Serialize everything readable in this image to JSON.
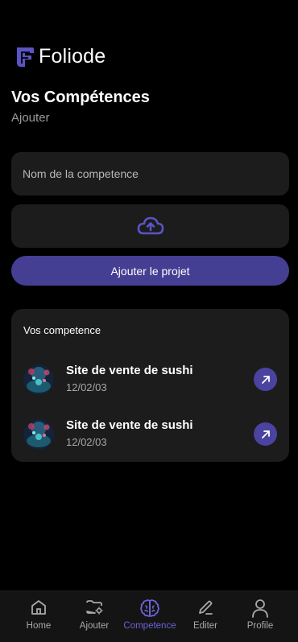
{
  "app": {
    "name": "Foliode"
  },
  "page": {
    "title": "Vos Compétences",
    "subtitle": "Ajouter"
  },
  "form": {
    "name_placeholder": "Nom de la competence",
    "name_value": "",
    "upload_icon": "cloud-upload-icon",
    "submit_label": "Ajouter le projet"
  },
  "list": {
    "title": "Vos competence",
    "items": [
      {
        "title": "Site de vente de sushi",
        "date": "12/02/03",
        "action_icon": "arrow-up-right-icon"
      },
      {
        "title": "Site de vente de sushi",
        "date": "12/02/03",
        "action_icon": "arrow-up-right-icon"
      }
    ]
  },
  "nav": {
    "active": "Competence",
    "items": [
      {
        "label": "Home",
        "icon": "home-icon"
      },
      {
        "label": "Ajouter",
        "icon": "folder-settings-icon"
      },
      {
        "label": "Competence",
        "icon": "brain-icon"
      },
      {
        "label": "Editer",
        "icon": "pencil-icon"
      },
      {
        "label": "Profile",
        "icon": "user-icon"
      }
    ]
  },
  "colors": {
    "background": "#000000",
    "card": "#1c1c1c",
    "accent": "#453f93",
    "accent_active": "#6c63d6",
    "muted_text": "#9a9a9a"
  }
}
